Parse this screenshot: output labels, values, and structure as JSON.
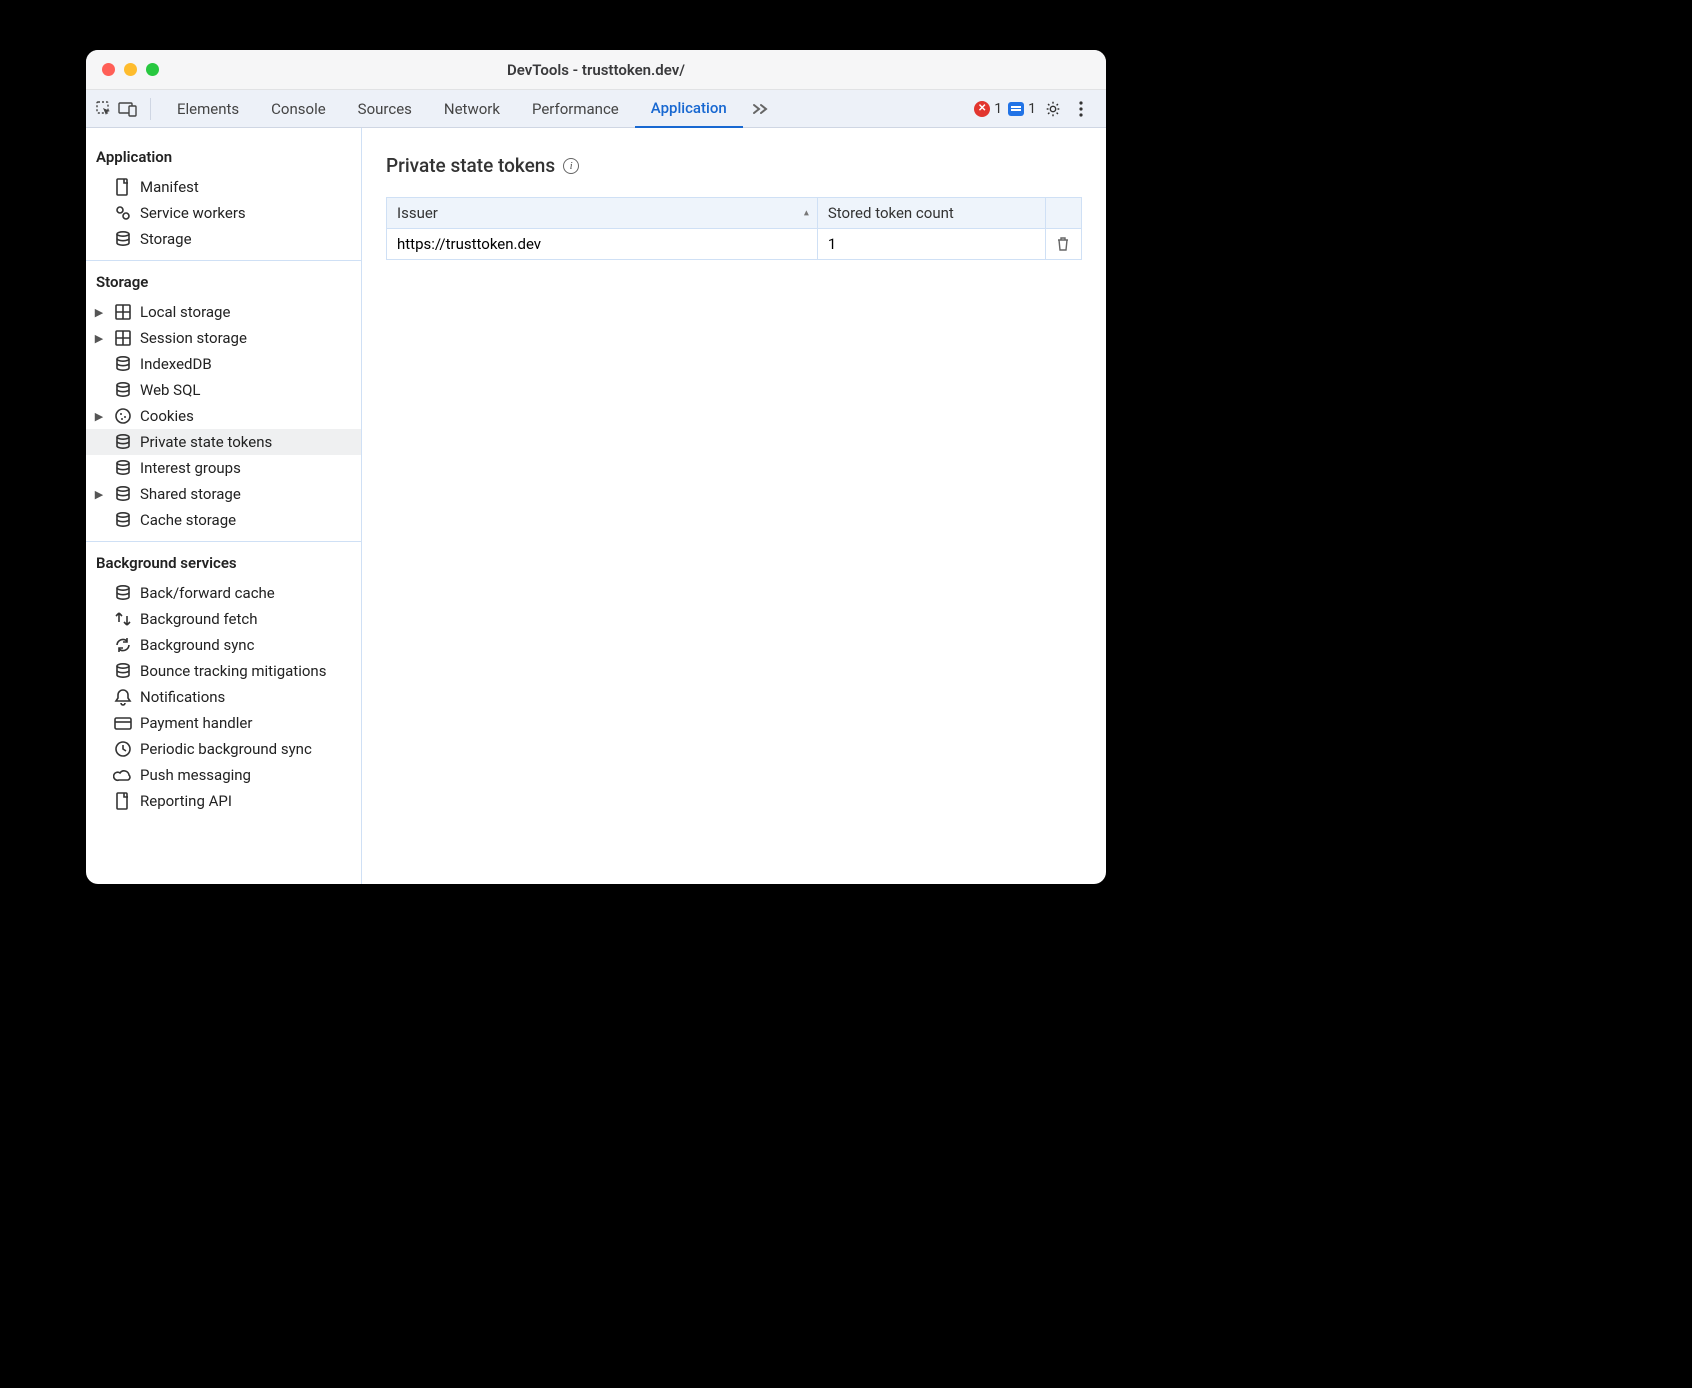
{
  "window_title": "DevTools - trusttoken.dev/",
  "toolbar": {
    "tabs": [
      "Elements",
      "Console",
      "Sources",
      "Network",
      "Performance",
      "Application"
    ],
    "active_tab": "Application",
    "error_count": "1",
    "info_count": "1"
  },
  "sidebar": {
    "sections": [
      {
        "title": "Application",
        "items": [
          {
            "label": "Manifest",
            "icon": "file",
            "arrow": false,
            "selected": false
          },
          {
            "label": "Service workers",
            "icon": "gears",
            "arrow": false,
            "selected": false
          },
          {
            "label": "Storage",
            "icon": "db",
            "arrow": false,
            "selected": false
          }
        ]
      },
      {
        "title": "Storage",
        "items": [
          {
            "label": "Local storage",
            "icon": "grid",
            "arrow": true,
            "selected": false
          },
          {
            "label": "Session storage",
            "icon": "grid",
            "arrow": true,
            "selected": false
          },
          {
            "label": "IndexedDB",
            "icon": "db",
            "arrow": false,
            "selected": false
          },
          {
            "label": "Web SQL",
            "icon": "db",
            "arrow": false,
            "selected": false
          },
          {
            "label": "Cookies",
            "icon": "cookie",
            "arrow": true,
            "selected": false
          },
          {
            "label": "Private state tokens",
            "icon": "db",
            "arrow": false,
            "selected": true
          },
          {
            "label": "Interest groups",
            "icon": "db",
            "arrow": false,
            "selected": false
          },
          {
            "label": "Shared storage",
            "icon": "db",
            "arrow": true,
            "selected": false
          },
          {
            "label": "Cache storage",
            "icon": "db",
            "arrow": false,
            "selected": false
          }
        ]
      },
      {
        "title": "Background services",
        "items": [
          {
            "label": "Back/forward cache",
            "icon": "db",
            "arrow": false,
            "selected": false
          },
          {
            "label": "Background fetch",
            "icon": "transfer",
            "arrow": false,
            "selected": false
          },
          {
            "label": "Background sync",
            "icon": "sync",
            "arrow": false,
            "selected": false
          },
          {
            "label": "Bounce tracking mitigations",
            "icon": "db",
            "arrow": false,
            "selected": false
          },
          {
            "label": "Notifications",
            "icon": "bell",
            "arrow": false,
            "selected": false
          },
          {
            "label": "Payment handler",
            "icon": "card",
            "arrow": false,
            "selected": false
          },
          {
            "label": "Periodic background sync",
            "icon": "clock",
            "arrow": false,
            "selected": false
          },
          {
            "label": "Push messaging",
            "icon": "cloud",
            "arrow": false,
            "selected": false
          },
          {
            "label": "Reporting API",
            "icon": "file",
            "arrow": false,
            "selected": false
          }
        ]
      }
    ]
  },
  "pane": {
    "heading": "Private state tokens",
    "columns": [
      "Issuer",
      "Stored token count"
    ],
    "rows": [
      {
        "issuer": "https://trusttoken.dev",
        "count": "1"
      }
    ]
  }
}
